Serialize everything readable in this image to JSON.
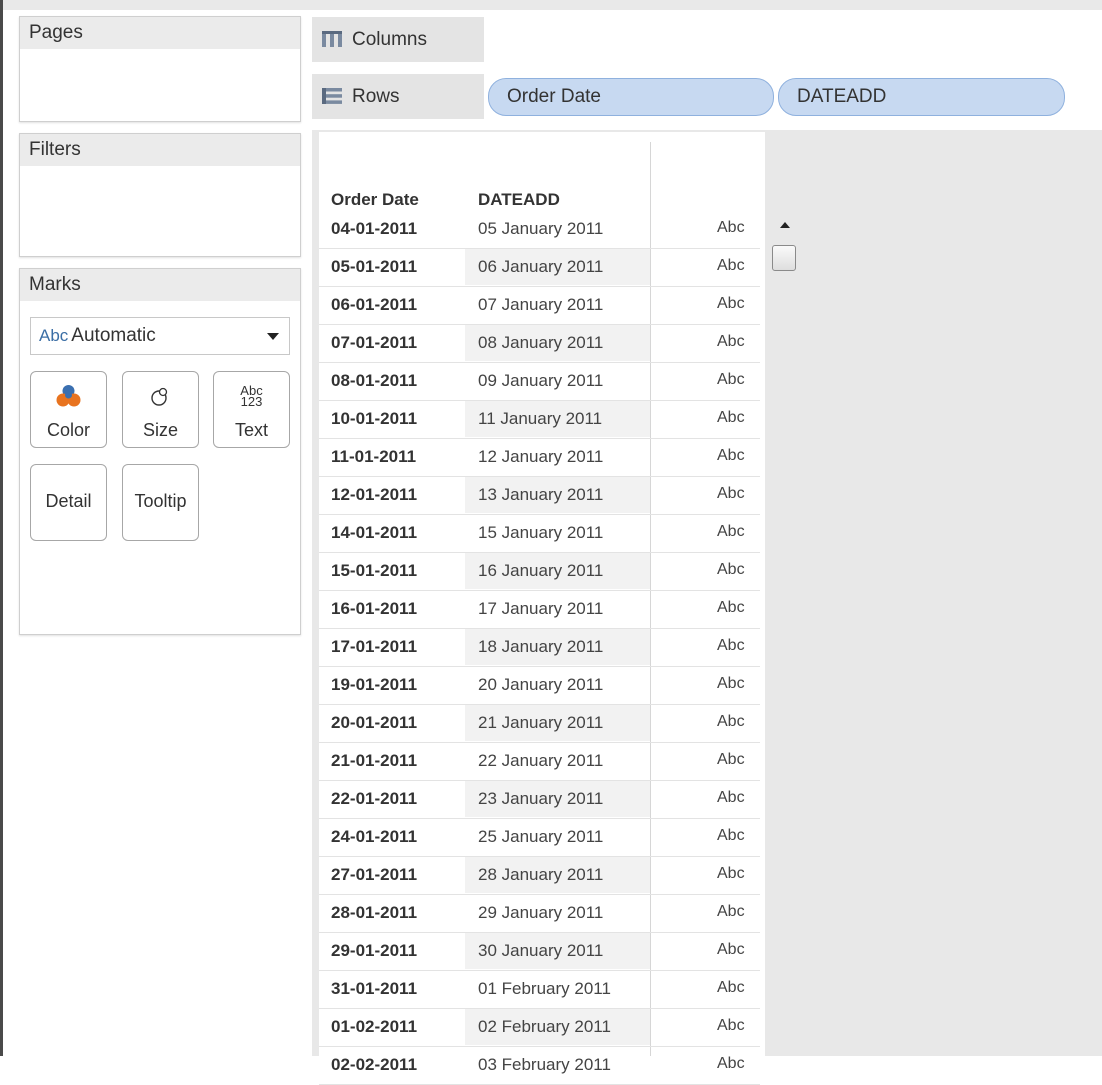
{
  "shelves": {
    "pages_title": "Pages",
    "filters_title": "Filters",
    "marks_title": "Marks",
    "columns_label": "Columns",
    "rows_label": "Rows",
    "row_pills": [
      "Order Date",
      "DATEADD"
    ]
  },
  "marks": {
    "type_icon_text": "Abc",
    "type_value": "Automatic",
    "buttons": {
      "color": "Color",
      "size": "Size",
      "text": "Text",
      "text_icon_top": "Abc",
      "text_icon_bottom": "123",
      "detail": "Detail",
      "tooltip": "Tooltip"
    }
  },
  "table": {
    "headers": [
      "Order Date",
      "DATEADD"
    ],
    "rows": [
      {
        "order_date": "04-01-2011",
        "dateadd": "05 January 2011",
        "mark": "Abc"
      },
      {
        "order_date": "05-01-2011",
        "dateadd": "06 January 2011",
        "mark": "Abc"
      },
      {
        "order_date": "06-01-2011",
        "dateadd": "07 January 2011",
        "mark": "Abc"
      },
      {
        "order_date": "07-01-2011",
        "dateadd": "08 January 2011",
        "mark": "Abc"
      },
      {
        "order_date": "08-01-2011",
        "dateadd": "09 January 2011",
        "mark": "Abc"
      },
      {
        "order_date": "10-01-2011",
        "dateadd": "11 January 2011",
        "mark": "Abc"
      },
      {
        "order_date": "11-01-2011",
        "dateadd": "12 January 2011",
        "mark": "Abc"
      },
      {
        "order_date": "12-01-2011",
        "dateadd": "13 January 2011",
        "mark": "Abc"
      },
      {
        "order_date": "14-01-2011",
        "dateadd": "15 January 2011",
        "mark": "Abc"
      },
      {
        "order_date": "15-01-2011",
        "dateadd": "16 January 2011",
        "mark": "Abc"
      },
      {
        "order_date": "16-01-2011",
        "dateadd": "17 January 2011",
        "mark": "Abc"
      },
      {
        "order_date": "17-01-2011",
        "dateadd": "18 January 2011",
        "mark": "Abc"
      },
      {
        "order_date": "19-01-2011",
        "dateadd": "20 January 2011",
        "mark": "Abc"
      },
      {
        "order_date": "20-01-2011",
        "dateadd": "21 January 2011",
        "mark": "Abc"
      },
      {
        "order_date": "21-01-2011",
        "dateadd": "22 January 2011",
        "mark": "Abc"
      },
      {
        "order_date": "22-01-2011",
        "dateadd": "23 January 2011",
        "mark": "Abc"
      },
      {
        "order_date": "24-01-2011",
        "dateadd": "25 January 2011",
        "mark": "Abc"
      },
      {
        "order_date": "27-01-2011",
        "dateadd": "28 January 2011",
        "mark": "Abc"
      },
      {
        "order_date": "28-01-2011",
        "dateadd": "29 January 2011",
        "mark": "Abc"
      },
      {
        "order_date": "29-01-2011",
        "dateadd": "30 January 2011",
        "mark": "Abc"
      },
      {
        "order_date": "31-01-2011",
        "dateadd": "01 February 2011",
        "mark": "Abc"
      },
      {
        "order_date": "01-02-2011",
        "dateadd": "02 February 2011",
        "mark": "Abc"
      },
      {
        "order_date": "02-02-2011",
        "dateadd": "03 February 2011",
        "mark": "Abc"
      }
    ]
  },
  "colors": {
    "pill_fill": "#c7d9f1",
    "pill_border": "#8fb1de",
    "shelf_label_bg": "#e4e4e4",
    "view_bg": "#e8e8e8",
    "color_icon_blue": "#3a6fb0",
    "color_icon_orange": "#e8731f"
  },
  "icons": {
    "columns": "columns-icon",
    "rows": "rows-icon",
    "color": "color-icon",
    "size": "size-icon",
    "dropdown": "chevron-down-icon",
    "scroll_up": "scroll-up-arrow-icon"
  }
}
